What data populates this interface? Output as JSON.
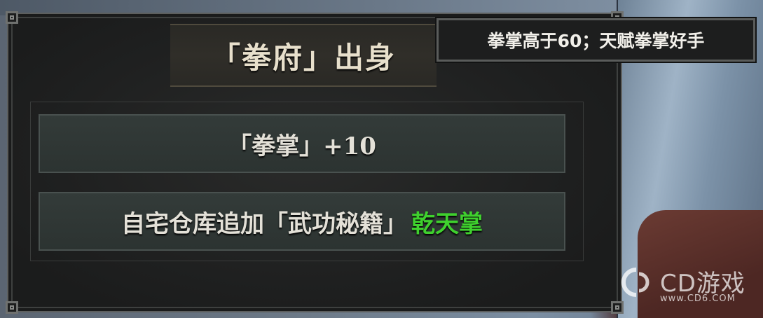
{
  "panel": {
    "title": "「拳府」出身",
    "rows": [
      {
        "text": "「拳掌」+10",
        "highlight": ""
      },
      {
        "text": "自宅仓库追加「武功秘籍」",
        "highlight": "乾天掌"
      }
    ]
  },
  "tooltip": {
    "text": "拳掌高于60；天赋拳掌好手"
  },
  "watermark": {
    "name": "CD游戏",
    "url": "www.CD6.COM"
  },
  "colors": {
    "highlight": "#3fd12e",
    "text": "#e4e1d8",
    "title": "#e8e0cc"
  },
  "icons": {
    "watermark_logo": "cd-logo-icon"
  }
}
